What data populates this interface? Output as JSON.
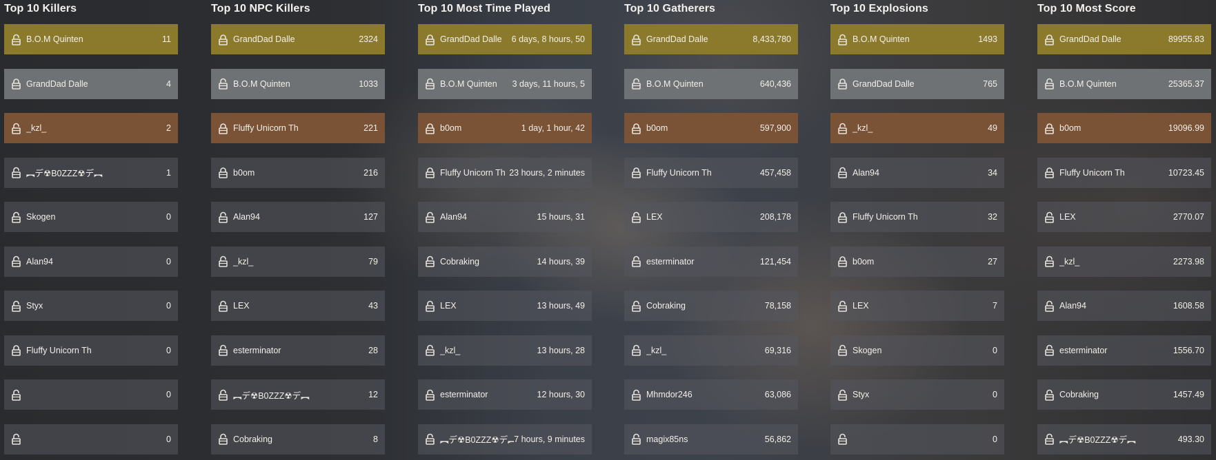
{
  "leaderboards": [
    {
      "title": "Top 10 Killers",
      "rows": [
        {
          "name": "B.O.M Quinten",
          "value": "11",
          "icon": "unlocked-padlock-icon"
        },
        {
          "name": "GrandDad Dalle",
          "value": "4",
          "icon": "locked-padlock-icon"
        },
        {
          "name": "_kzl_",
          "value": "2",
          "icon": "unlocked-padlock-icon"
        },
        {
          "name": "︻デ☢B0ZZZ☢デ︻",
          "value": "1",
          "icon": "unlocked-padlock-icon"
        },
        {
          "name": "Skogen",
          "value": "0",
          "icon": "unlocked-padlock-icon"
        },
        {
          "name": "Alan94",
          "value": "0",
          "icon": "unlocked-padlock-icon"
        },
        {
          "name": "Styx",
          "value": "0",
          "icon": "unlocked-padlock-icon"
        },
        {
          "name": "Fluffy Unicorn Th",
          "value": "0",
          "icon": "locked-padlock-icon"
        },
        {
          "name": "",
          "value": "0",
          "icon": "unlocked-padlock-icon"
        },
        {
          "name": "",
          "value": "0",
          "icon": "unlocked-padlock-icon"
        }
      ]
    },
    {
      "title": "Top 10 NPC Killers",
      "rows": [
        {
          "name": "GrandDad Dalle",
          "value": "2324",
          "icon": "locked-padlock-icon"
        },
        {
          "name": "B.O.M Quinten",
          "value": "1033",
          "icon": "unlocked-padlock-icon"
        },
        {
          "name": "Fluffy Unicorn Th",
          "value": "221",
          "icon": "locked-padlock-icon"
        },
        {
          "name": "b0om",
          "value": "216",
          "icon": "locked-padlock-icon"
        },
        {
          "name": "Alan94",
          "value": "127",
          "icon": "unlocked-padlock-icon"
        },
        {
          "name": "_kzl_",
          "value": "79",
          "icon": "unlocked-padlock-icon"
        },
        {
          "name": "LEX",
          "value": "43",
          "icon": "unlocked-padlock-icon"
        },
        {
          "name": "esterminator",
          "value": "28",
          "icon": "unlocked-padlock-icon"
        },
        {
          "name": "︻デ☢B0ZZZ☢デ︻",
          "value": "12",
          "icon": "unlocked-padlock-icon"
        },
        {
          "name": "Cobraking",
          "value": "8",
          "icon": "unlocked-padlock-icon"
        }
      ]
    },
    {
      "title": "Top 10 Most Time Played",
      "rows": [
        {
          "name": "GrandDad Dalle",
          "value": "6 days, 8 hours, 50",
          "icon": "locked-padlock-icon"
        },
        {
          "name": "B.O.M Quinten",
          "value": "3 days, 11 hours, 5",
          "icon": "unlocked-padlock-icon"
        },
        {
          "name": "b0om",
          "value": "1 day, 1 hour, 42",
          "icon": "locked-padlock-icon"
        },
        {
          "name": "Fluffy Unicorn Th",
          "value": "23 hours, 2 minutes",
          "icon": "locked-padlock-icon"
        },
        {
          "name": "Alan94",
          "value": "15 hours, 31",
          "icon": "unlocked-padlock-icon"
        },
        {
          "name": "Cobraking",
          "value": "14 hours, 39",
          "icon": "unlocked-padlock-icon"
        },
        {
          "name": "LEX",
          "value": "13 hours, 49",
          "icon": "unlocked-padlock-icon"
        },
        {
          "name": "_kzl_",
          "value": "13 hours, 28",
          "icon": "unlocked-padlock-icon"
        },
        {
          "name": "esterminator",
          "value": "12 hours, 30",
          "icon": "unlocked-padlock-icon"
        },
        {
          "name": "︻デ☢B0ZZZ☢デ︻",
          "value": "7 hours, 9 minutes",
          "icon": "unlocked-padlock-icon"
        }
      ]
    },
    {
      "title": "Top 10 Gatherers",
      "rows": [
        {
          "name": "GrandDad Dalle",
          "value": "8,433,780",
          "icon": "locked-padlock-icon"
        },
        {
          "name": "B.O.M Quinten",
          "value": "640,436",
          "icon": "unlocked-padlock-icon"
        },
        {
          "name": "b0om",
          "value": "597,900",
          "icon": "locked-padlock-icon"
        },
        {
          "name": "Fluffy Unicorn Th",
          "value": "457,458",
          "icon": "locked-padlock-icon"
        },
        {
          "name": "LEX",
          "value": "208,178",
          "icon": "unlocked-padlock-icon"
        },
        {
          "name": "esterminator",
          "value": "121,454",
          "icon": "unlocked-padlock-icon"
        },
        {
          "name": "Cobraking",
          "value": "78,158",
          "icon": "unlocked-padlock-icon"
        },
        {
          "name": "_kzl_",
          "value": "69,316",
          "icon": "unlocked-padlock-icon"
        },
        {
          "name": "Mhmdor246",
          "value": "63,086",
          "icon": "unlocked-padlock-icon"
        },
        {
          "name": "magix85ns",
          "value": "56,862",
          "icon": "unlocked-padlock-icon"
        }
      ]
    },
    {
      "title": "Top 10 Explosions",
      "rows": [
        {
          "name": "B.O.M Quinten",
          "value": "1493",
          "icon": "unlocked-padlock-icon"
        },
        {
          "name": "GrandDad Dalle",
          "value": "765",
          "icon": "locked-padlock-icon"
        },
        {
          "name": "_kzl_",
          "value": "49",
          "icon": "unlocked-padlock-icon"
        },
        {
          "name": "Alan94",
          "value": "34",
          "icon": "unlocked-padlock-icon"
        },
        {
          "name": "Fluffy Unicorn Th",
          "value": "32",
          "icon": "locked-padlock-icon"
        },
        {
          "name": "b0om",
          "value": "27",
          "icon": "locked-padlock-icon"
        },
        {
          "name": "LEX",
          "value": "7",
          "icon": "unlocked-padlock-icon"
        },
        {
          "name": "Skogen",
          "value": "0",
          "icon": "unlocked-padlock-icon"
        },
        {
          "name": "Styx",
          "value": "0",
          "icon": "unlocked-padlock-icon"
        },
        {
          "name": "",
          "value": "0",
          "icon": "unlocked-padlock-icon"
        }
      ]
    },
    {
      "title": "Top 10 Most Score",
      "rows": [
        {
          "name": "GrandDad Dalle",
          "value": "89955.83",
          "icon": "locked-padlock-icon"
        },
        {
          "name": "B.O.M Quinten",
          "value": "25365.37",
          "icon": "unlocked-padlock-icon"
        },
        {
          "name": "b0om",
          "value": "19096.99",
          "icon": "locked-padlock-icon"
        },
        {
          "name": "Fluffy Unicorn Th",
          "value": "10723.45",
          "icon": "locked-padlock-icon"
        },
        {
          "name": "LEX",
          "value": "2770.07",
          "icon": "unlocked-padlock-icon"
        },
        {
          "name": "_kzl_",
          "value": "2273.98",
          "icon": "unlocked-padlock-icon"
        },
        {
          "name": "Alan94",
          "value": "1608.58",
          "icon": "unlocked-padlock-icon"
        },
        {
          "name": "esterminator",
          "value": "1556.70",
          "icon": "unlocked-padlock-icon"
        },
        {
          "name": "Cobraking",
          "value": "1457.49",
          "icon": "unlocked-padlock-icon"
        },
        {
          "name": "︻デ☢B0ZZZ☢デ︻",
          "value": "493.30",
          "icon": "unlocked-padlock-icon"
        }
      ]
    }
  ],
  "colors": {
    "rank_1": "#8c7a2c",
    "rank_2": "#6f7275",
    "rank_3": "#7a5236",
    "row_default": "rgba(85,88,94,0.55)",
    "text": "#f2efe9"
  }
}
